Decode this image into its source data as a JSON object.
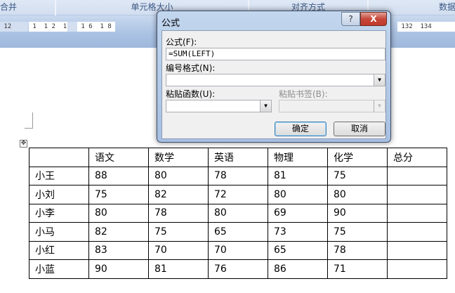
{
  "ribbon": {
    "groups": [
      "合并",
      "单元格大小",
      "对齐方式",
      "数据"
    ]
  },
  "ruler": {
    "left_marks": " 12 ",
    "seg2": " 1  1 2  1 4",
    "seg3": " 1 6  1 8 ",
    "right_marks": " 132  134"
  },
  "dialog": {
    "title": "公式",
    "help_label": "?",
    "close_label": "X",
    "formula_label": "公式(F):",
    "formula_value": "=SUM(LEFT)",
    "number_format_label": "编号格式(N):",
    "number_format_value": "",
    "paste_function_label": "粘贴函数(U):",
    "paste_bookmark_label": "粘贴书签(B):",
    "ok_label": "确定",
    "cancel_label": "取消",
    "dropdown_arrow": "▼"
  },
  "table": {
    "move_handle": "✥",
    "header": [
      "",
      "语文",
      "数学",
      "英语",
      "物理",
      "化学",
      "总分"
    ],
    "rows": [
      [
        "小王",
        "88",
        "80",
        "78",
        "81",
        "75",
        ""
      ],
      [
        "小刘",
        "75",
        "82",
        "72",
        "80",
        "80",
        ""
      ],
      [
        "小李",
        "80",
        "78",
        "80",
        "69",
        "90",
        ""
      ],
      [
        "小马",
        "82",
        "75",
        "65",
        "73",
        "75",
        ""
      ],
      [
        "小红",
        "83",
        "70",
        "70",
        "65",
        "78",
        ""
      ],
      [
        "小蓝",
        "90",
        "81",
        "76",
        "86",
        "71",
        ""
      ]
    ]
  }
}
